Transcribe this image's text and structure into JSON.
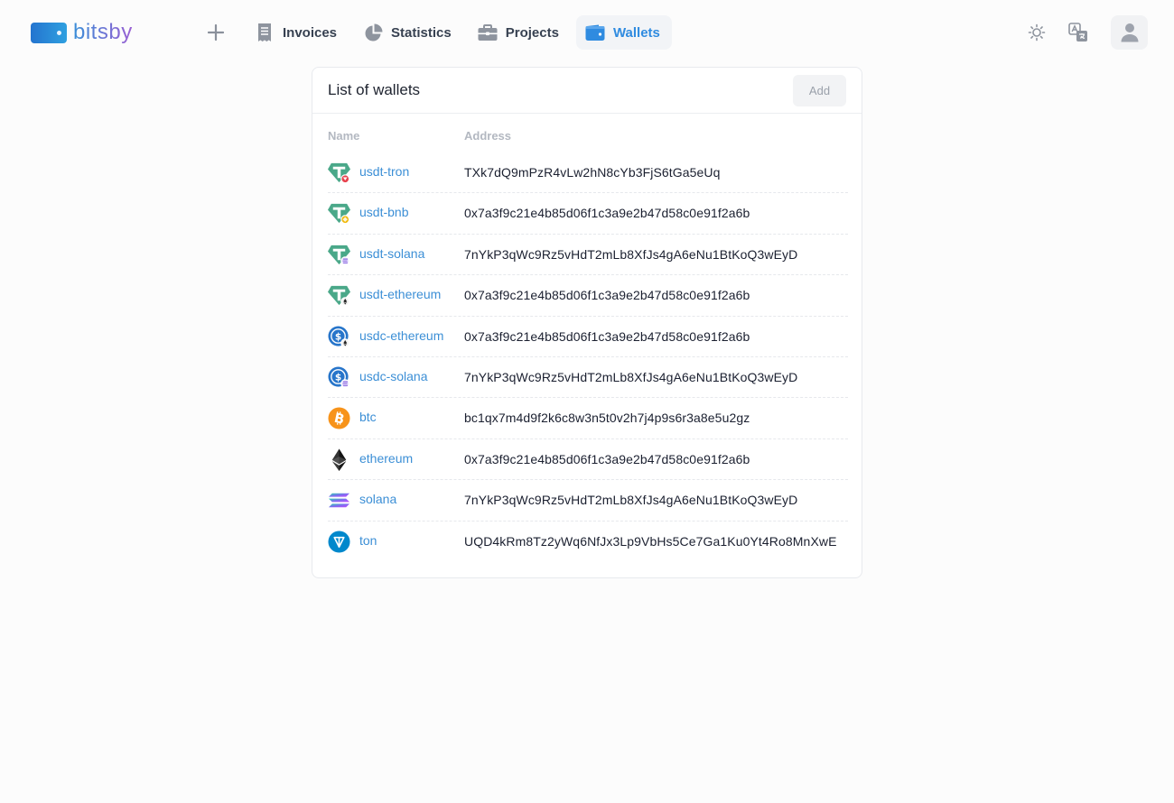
{
  "brand": {
    "name": "bitsby"
  },
  "nav": {
    "items": [
      {
        "label": "Invoices",
        "icon": "receipt-icon",
        "active": false
      },
      {
        "label": "Statistics",
        "icon": "pie-chart-icon",
        "active": false
      },
      {
        "label": "Projects",
        "icon": "briefcase-icon",
        "active": false
      },
      {
        "label": "Wallets",
        "icon": "wallet-icon",
        "active": true
      }
    ]
  },
  "header_actions": {
    "theme_icon": "sun-icon",
    "language_icon": "translate-icon",
    "profile_icon": "user-icon"
  },
  "colors": {
    "accent": "#2f8be0",
    "link": "#3c8fd6",
    "tether": "#4aa889",
    "usdc": "#2775ca",
    "btc": "#f7931a",
    "ton": "#0088cc"
  },
  "wallets": {
    "title": "List of wallets",
    "add_label": "Add",
    "columns": {
      "name": "Name",
      "address": "Address"
    },
    "rows": [
      {
        "name": "usdt-tron",
        "address": "TXk7dQ9mPzR4vLw2hN8cYb3FjS6tGa5eUq",
        "icon": "usdt-tron-icon"
      },
      {
        "name": "usdt-bnb",
        "address": "0x7a3f9c21e4b85d06f1c3a9e2b47d58c0e91f2a6b",
        "icon": "usdt-bnb-icon"
      },
      {
        "name": "usdt-solana",
        "address": "7nYkP3qWc9Rz5vHdT2mLb8XfJs4gA6eNu1BtKoQ3wEyD",
        "icon": "usdt-solana-icon"
      },
      {
        "name": "usdt-ethereum",
        "address": "0x7a3f9c21e4b85d06f1c3a9e2b47d58c0e91f2a6b",
        "icon": "usdt-ethereum-icon"
      },
      {
        "name": "usdc-ethereum",
        "address": "0x7a3f9c21e4b85d06f1c3a9e2b47d58c0e91f2a6b",
        "icon": "usdc-ethereum-icon"
      },
      {
        "name": "usdc-solana",
        "address": "7nYkP3qWc9Rz5vHdT2mLb8XfJs4gA6eNu1BtKoQ3wEyD",
        "icon": "usdc-solana-icon"
      },
      {
        "name": "btc",
        "address": "bc1qx7m4d9f2k6c8w3n5t0v2h7j4p9s6r3a8e5u2gz",
        "icon": "bitcoin-icon"
      },
      {
        "name": "ethereum",
        "address": "0x7a3f9c21e4b85d06f1c3a9e2b47d58c0e91f2a6b",
        "icon": "ethereum-icon"
      },
      {
        "name": "solana",
        "address": "7nYkP3qWc9Rz5vHdT2mLb8XfJs4gA6eNu1BtKoQ3wEyD",
        "icon": "solana-icon"
      },
      {
        "name": "ton",
        "address": "UQD4kRm8Tz2yWq6NfJx3Lp9VbHs5Ce7Ga1Ku0Yt4Ro8MnXwE",
        "icon": "ton-icon"
      }
    ]
  }
}
